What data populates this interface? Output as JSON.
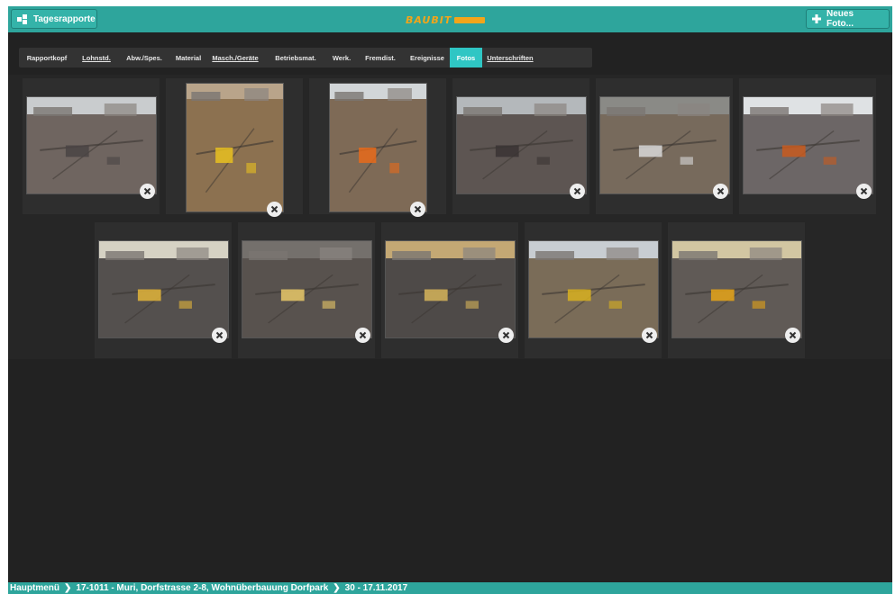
{
  "header": {
    "back_label": "Tagesrapporte",
    "logo_text": "BAUBIT",
    "new_photo_label": "Neues Foto..."
  },
  "tabs": [
    {
      "label": "Rapportkopf",
      "underline": false,
      "active": false
    },
    {
      "label": "Lohnstd.",
      "underline": true,
      "active": false
    },
    {
      "label": "Abw./Spes.",
      "underline": false,
      "active": false
    },
    {
      "label": "Material",
      "underline": false,
      "active": false
    },
    {
      "label": "Masch./Geräte",
      "underline": true,
      "active": false
    },
    {
      "label": "Betriebsmat.",
      "underline": false,
      "active": false
    },
    {
      "label": "Werk.",
      "underline": false,
      "active": false
    },
    {
      "label": "Fremdist.",
      "underline": false,
      "active": false
    },
    {
      "label": "Ereignisse",
      "underline": false,
      "active": false
    },
    {
      "label": "Fotos",
      "underline": false,
      "active": true
    },
    {
      "label": "Unterschriften",
      "underline": true,
      "active": false
    }
  ],
  "photos_row1": [
    {
      "orientation": "landscape",
      "sky": "#c9ccce",
      "ground": "#6f6560",
      "accent": "#4a4444"
    },
    {
      "orientation": "portrait",
      "sky": "#b9a48a",
      "ground": "#8c7150",
      "accent": "#e8c020"
    },
    {
      "orientation": "portrait",
      "sky": "#d2d6d8",
      "ground": "#7e6a56",
      "accent": "#e86a1a"
    },
    {
      "orientation": "landscape",
      "sky": "#b4b8bb",
      "ground": "#5d5552",
      "accent": "#3a3434"
    },
    {
      "orientation": "landscape",
      "sky": "#8a8a86",
      "ground": "#776a5c",
      "accent": "#d8d8d8"
    },
    {
      "orientation": "landscape",
      "sky": "#dfe2e4",
      "ground": "#6c6666",
      "accent": "#c85a1e"
    }
  ],
  "photos_row2": [
    {
      "orientation": "landscape",
      "sky": "#d6d2c4",
      "ground": "#54504e",
      "accent": "#e2b43a"
    },
    {
      "orientation": "landscape",
      "sky": "#74706c",
      "ground": "#58524e",
      "accent": "#e8c868"
    },
    {
      "orientation": "landscape",
      "sky": "#c4a874",
      "ground": "#4e4a48",
      "accent": "#d6b45a"
    },
    {
      "orientation": "landscape",
      "sky": "#c8cdd2",
      "ground": "#7a6c58",
      "accent": "#d8b020"
    },
    {
      "orientation": "landscape",
      "sky": "#d2c6a2",
      "ground": "#605a56",
      "accent": "#e6a418"
    }
  ],
  "breadcrumb": [
    "Hauptmenü",
    "17-1011 - Muri, Dorfstrasse 2-8, Wohnüberbauung Dorfpark",
    "30 - 17.11.2017"
  ],
  "colors": {
    "teal": "#2ea59c",
    "active_tab": "#2fc6c4",
    "background": "#222222"
  }
}
